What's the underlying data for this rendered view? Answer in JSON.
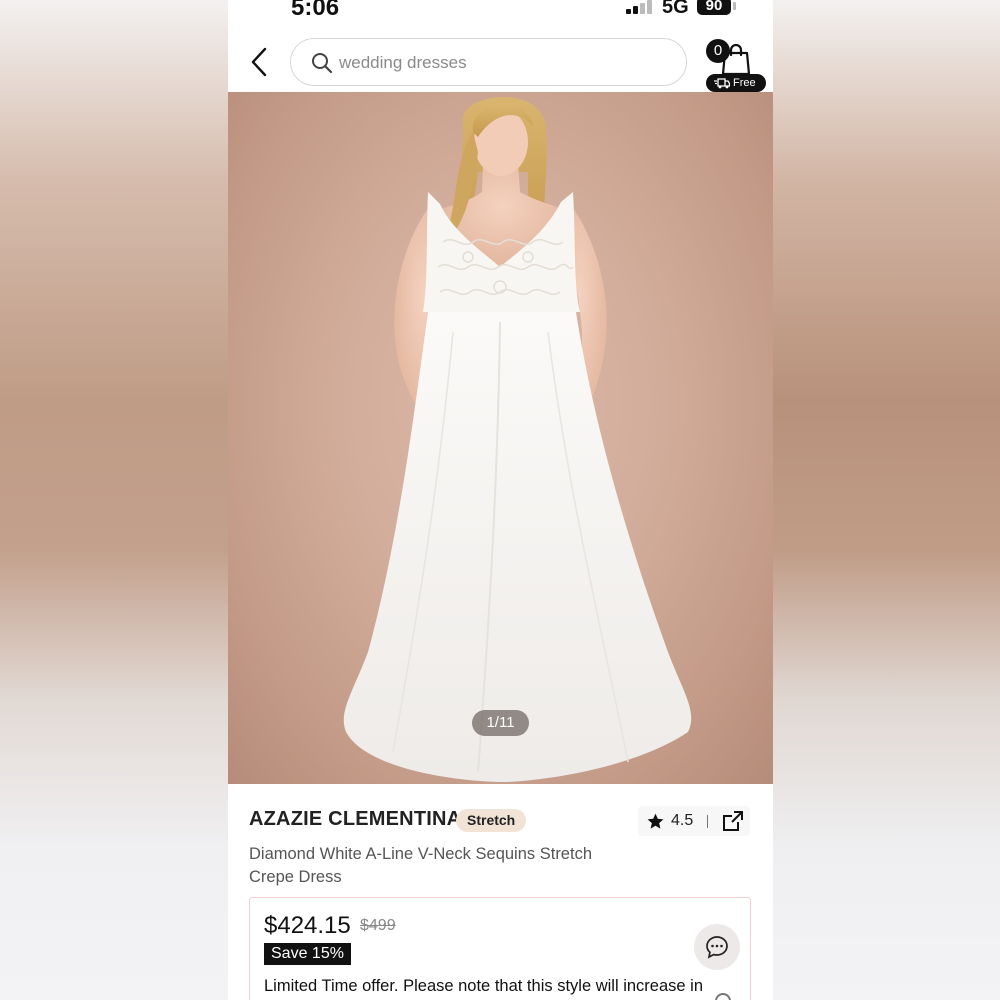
{
  "status_bar": {
    "time": "5:06",
    "network": "5G",
    "battery": "90"
  },
  "header": {
    "search_placeholder": "wedding dresses",
    "cart_count": "0",
    "free_shipping_label": "Free"
  },
  "gallery": {
    "indicator": "1/11"
  },
  "product": {
    "brand": "AZAZIE CLEMENTINA",
    "badge": "Stretch",
    "rating": "4.5",
    "name": "Diamond White A-Line V-Neck Sequins Stretch Crepe Dress"
  },
  "pricing": {
    "price": "$424.15",
    "original_price": "$499",
    "save_badge": "Save 15%",
    "offer_text": "Limited Time offer. Please note that this style will increase in"
  },
  "icons": [
    "back-icon",
    "search-icon",
    "cart-icon",
    "shipping-icon",
    "star-icon",
    "share-icon",
    "chat-icon",
    "info-icon"
  ]
}
